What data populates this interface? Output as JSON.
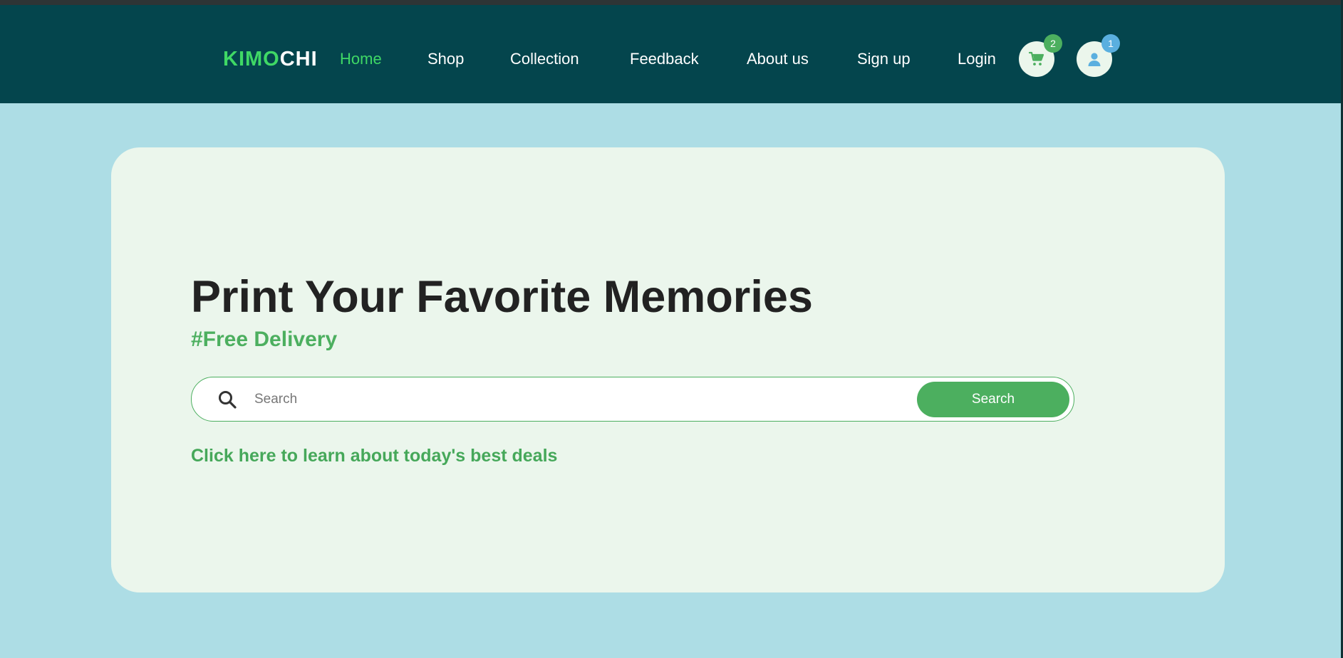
{
  "brand": {
    "part1": "KIMO",
    "part2": "CHI",
    "accent_color": "#3fd865",
    "nav_bg_color": "#04454d"
  },
  "nav": {
    "links": [
      {
        "label": "Home",
        "active": true
      },
      {
        "label": "Shop"
      },
      {
        "label": "Collection"
      },
      {
        "label": "Feedback"
      },
      {
        "label": "About us"
      },
      {
        "label": "Sign up"
      },
      {
        "label": "Login"
      }
    ],
    "cart": {
      "icon": "cart-icon",
      "count": "2"
    },
    "user": {
      "icon": "user-icon",
      "count": "1"
    }
  },
  "hero": {
    "title": "Print Your Favorite Memories",
    "subtitle": "#Free Delivery",
    "search": {
      "placeholder": "Search",
      "value": "",
      "button_label": "Search",
      "icon": "search-icon"
    },
    "deals_link": "Click here to learn about today's best deals",
    "card_bg_color": "#ebf6ec",
    "button_color": "#4caf5f"
  },
  "page_bg_color": "#addde5"
}
